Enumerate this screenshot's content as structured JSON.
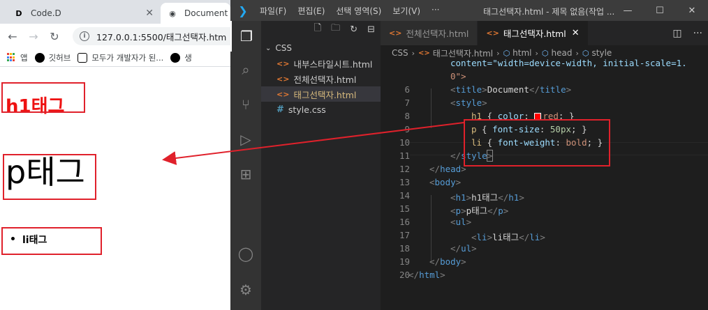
{
  "browser": {
    "tabs": [
      {
        "label": "Code.D",
        "favicon": "code-d-icon"
      },
      {
        "label": "Document",
        "favicon": "globe-icon"
      }
    ],
    "url": "127.0.0.1:5500/태그선택자.htm",
    "bookmarks": [
      "앱",
      "깃허브",
      "모두가 개발자가 된...",
      "생"
    ],
    "page": {
      "h1": "h1태그",
      "p": "p태그",
      "li": "li태그"
    },
    "colors": {
      "h1": "#e11111",
      "annotation": "#e0212b"
    }
  },
  "vscode": {
    "menu": [
      "파일(F)",
      "편집(E)",
      "선택 영역(S)",
      "보기(V)",
      "···"
    ],
    "window_title": "태그선택자.html - 제목 없음(작업 ...",
    "explorer": {
      "folder": "CSS",
      "files": [
        {
          "name": "내부스타일시트.html",
          "type": "html"
        },
        {
          "name": "전체선택자.html",
          "type": "html"
        },
        {
          "name": "태그선택자.html",
          "type": "html"
        },
        {
          "name": "style.css",
          "type": "css"
        }
      ]
    },
    "tabs": [
      {
        "label": "전체선택자.html"
      },
      {
        "label": "태그선택자.html",
        "active": true
      }
    ],
    "breadcrumb": [
      "CSS",
      "태그선택자.html",
      "html",
      "head",
      "style"
    ],
    "line_numbers": [
      "6",
      "7",
      "8",
      "9",
      "10",
      "11",
      "12",
      "13",
      "14",
      "15",
      "16",
      "17",
      "18",
      "19",
      "20"
    ],
    "code": {
      "wrap1": "content=\"width=device-width, initial-scale=1.",
      "wrap2": "0\">",
      "l6_text": "Document",
      "l8_sel": "h1",
      "l8_prop": "color",
      "l8_val": "red",
      "l9_sel": "p",
      "l9_prop": "font-size",
      "l9_val": "50px",
      "l10_sel": "li",
      "l10_prop": "font-weight",
      "l10_val": "bold",
      "l14_text": "h1태그",
      "l15_text": "p태그",
      "l17_text": "li태그"
    },
    "accent": "#23a9f2"
  }
}
